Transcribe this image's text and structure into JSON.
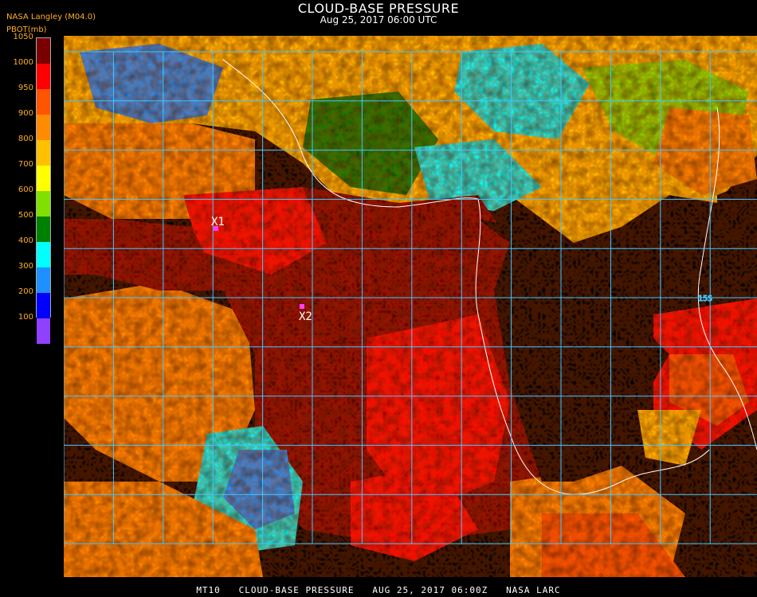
{
  "title": "CLOUD-BASE PRESSURE",
  "subtitle": "Aug 25, 2017 06:00 UTC",
  "source_label": "NASA Langley (M04.0)",
  "unit_label": "PBOT(mb)",
  "footer": "MT10   CLOUD-BASE PRESSURE   AUG 25, 2017 06:00Z   NASA LARC",
  "colorbar": {
    "ticks": [
      "1050",
      "1000",
      "950",
      "900",
      "850",
      "800",
      "750",
      "700",
      "650",
      "600",
      "550",
      "500",
      "450",
      "400",
      "350",
      "300",
      "250",
      "200",
      "150",
      "100"
    ],
    "labels": [
      "1050",
      "1000",
      "950",
      "900",
      "800",
      "700",
      "600",
      "500",
      "400",
      "300",
      "200",
      "100"
    ],
    "colors": [
      "#7a0000",
      "#ff0000",
      "#ff5500",
      "#ff8c00",
      "#ffc000",
      "#ffff00",
      "#80e000",
      "#008000",
      "#00ffff",
      "#1e90ff",
      "#0000ff",
      "#9040ff"
    ]
  },
  "markers": [
    {
      "label": "X1",
      "color": "#ff40ff"
    },
    {
      "label": "X2",
      "color": "#ff40ff"
    }
  ],
  "map": {
    "grid_color": "#40c8ff",
    "coast_color": "#ffffff",
    "grid_label": "15S"
  }
}
